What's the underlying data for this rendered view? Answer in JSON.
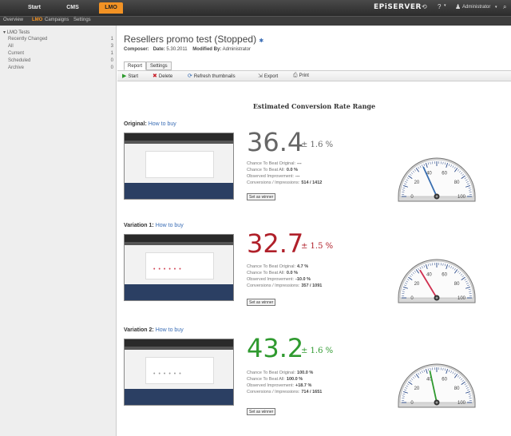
{
  "topnav": {
    "tabs": [
      {
        "label": "Start",
        "active": false
      },
      {
        "label": "CMS",
        "active": false
      },
      {
        "label": "LMO",
        "active": true
      }
    ],
    "brand": "EPiSERVER",
    "user": "Administrator",
    "help": "?"
  },
  "subnav": {
    "tabs": [
      {
        "label": "Overview",
        "active": false
      },
      {
        "label": "LMO",
        "active": true
      },
      {
        "label": "Campaigns",
        "active": false
      },
      {
        "label": "Settings",
        "active": false
      }
    ]
  },
  "sidebar": {
    "root": "LMO Tests",
    "items": [
      {
        "label": "Recently Changed",
        "count": "1"
      },
      {
        "label": "All",
        "count": "3"
      },
      {
        "label": "Current",
        "count": "1"
      },
      {
        "label": "Scheduled",
        "count": "0"
      },
      {
        "label": "Archive",
        "count": "0"
      }
    ]
  },
  "page": {
    "title": "Resellers promo test (Stopped)",
    "meta": {
      "composer_label": "Composer:",
      "composer_value": "",
      "date_label": "Date:",
      "date_value": "5.30.2011",
      "modified_label": "Modified By:",
      "modified_value": "Administrator"
    },
    "tabs": [
      "Report",
      "Settings"
    ],
    "toolbar": [
      {
        "icon": "play-icon",
        "glyph": "▶",
        "label": "Start"
      },
      {
        "icon": "delete-icon",
        "glyph": "✖",
        "label": "Delete"
      },
      {
        "icon": "refresh-icon",
        "glyph": "⟳",
        "label": "Refresh thumbnails"
      },
      {
        "icon": "export-icon",
        "glyph": "⇲",
        "label": "Export"
      },
      {
        "icon": "print-icon",
        "glyph": "⎙",
        "label": "Print"
      }
    ],
    "range_heading": "Estimated Conversion Rate Range"
  },
  "variations": [
    {
      "name": "Original:",
      "link": "How to buy",
      "rate": "36.4",
      "margin": "± 1.6 %",
      "color": "#666666",
      "needle_color": "#3a6fb0",
      "gauge_value": 36.4,
      "stats": [
        {
          "label": "Chance To Beat Original:",
          "value": "---"
        },
        {
          "label": "Chance To Beat All:",
          "value": "0.0 %"
        },
        {
          "label": "Observed Improvement:",
          "value": "---"
        },
        {
          "label": "Conversions / Impressions:",
          "value": "514 / 1412"
        }
      ],
      "button": "Set as winner"
    },
    {
      "name": "Variation 1:",
      "link": "How to buy",
      "rate": "32.7",
      "margin": "± 1.5 %",
      "color": "#b0202a",
      "needle_color": "#d03050",
      "gauge_value": 32.7,
      "stats": [
        {
          "label": "Chance To Beat Original:",
          "value": "4.7 %"
        },
        {
          "label": "Chance To Beat All:",
          "value": "0.0 %"
        },
        {
          "label": "Observed Improvement:",
          "value": "-10.0 %"
        },
        {
          "label": "Conversions / Impressions:",
          "value": "357 / 1091"
        }
      ],
      "button": "Set as winner"
    },
    {
      "name": "Variation 2:",
      "link": "How to buy",
      "rate": "43.2",
      "margin": "± 1.6 %",
      "color": "#2f9a2f",
      "needle_color": "#2f9a2f",
      "gauge_value": 43.2,
      "stats": [
        {
          "label": "Chance To Beat Original:",
          "value": "100.0 %"
        },
        {
          "label": "Chance To Beat All:",
          "value": "100.0 %"
        },
        {
          "label": "Observed Improvement:",
          "value": "+18.7 %"
        },
        {
          "label": "Conversions / Impressions:",
          "value": "714 / 1651"
        }
      ],
      "button": "Set as winner"
    }
  ],
  "gauge_ticks": [
    "0",
    "10",
    "20",
    "30",
    "40",
    "50",
    "60",
    "70",
    "80",
    "90",
    "100"
  ]
}
